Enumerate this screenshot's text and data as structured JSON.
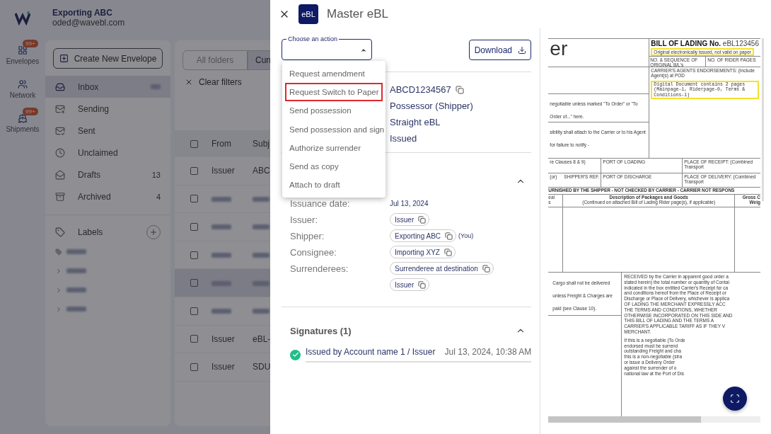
{
  "account": {
    "name": "Exporting ABC",
    "email": "oded@wavebl.com"
  },
  "rail": [
    {
      "label": "Envelopes",
      "badge": "99+"
    },
    {
      "label": "Network"
    },
    {
      "label": "Shipments",
      "badge": "99+"
    }
  ],
  "create_button": "Create New Envelope",
  "folders": [
    {
      "label": "Inbox",
      "selected": true,
      "count_blurred": true
    },
    {
      "label": "Sending",
      "selected": false
    },
    {
      "label": "Sent",
      "selected": false
    },
    {
      "label": "Unclaimed",
      "selected": false
    },
    {
      "label": "Drafts",
      "count": "13",
      "selected": false
    },
    {
      "label": "Archived",
      "count": "4",
      "selected": false
    }
  ],
  "labels": {
    "title": "Labels",
    "items": [
      {
        "expandable": false
      },
      {
        "expandable": true
      },
      {
        "expandable": true
      },
      {
        "expandable": true
      }
    ]
  },
  "filter_tabs": [
    {
      "label": "All folders",
      "selected": false
    },
    {
      "label": "Curr",
      "selected": true
    }
  ],
  "clear_filters": "Clear filters",
  "table": {
    "columns": [
      "From",
      "Subj"
    ],
    "rows": [
      {
        "from": "Issuer",
        "subject": "ABC",
        "blurred": false,
        "selected": false
      },
      {
        "blurred": true,
        "selected": false
      },
      {
        "blurred": true,
        "selected": false
      },
      {
        "blurred": true,
        "selected": false
      },
      {
        "blurred": true,
        "selected": true
      },
      {
        "blurred": true,
        "selected": false
      },
      {
        "from": "Issuer",
        "subject": "eBL-",
        "blurred": false,
        "selected": false
      },
      {
        "from": "Issuer",
        "subject": "SDU",
        "blurred": false,
        "selected": false
      }
    ]
  },
  "drawer": {
    "badge": "eBL",
    "title": "Master eBL",
    "action_select": {
      "label": "Choose an action",
      "expanded": true,
      "options": [
        {
          "label": "Request amendment",
          "outlined": false
        },
        {
          "label": "Request Switch to Paper",
          "outlined": true
        },
        {
          "label": "Send possession",
          "outlined": false
        },
        {
          "label": "Send possession and sign",
          "outlined": false
        },
        {
          "label": "Authorize surrender",
          "outlined": false
        },
        {
          "label": "Send as copy",
          "outlined": false
        },
        {
          "label": "Attach to draft",
          "outlined": false
        }
      ]
    },
    "download": "Download",
    "details": [
      {
        "value": "ABCD1234567",
        "copyable": true
      },
      {
        "value": "Possessor (Shipper)",
        "copyable": false
      },
      {
        "value": "Straight eBL",
        "copyable": false
      },
      {
        "value": "Issued",
        "copyable": false
      }
    ],
    "parties": {
      "expanded": true,
      "rows": [
        {
          "label": "Issuance date:",
          "kind": "text",
          "value": "Jul 13, 2024"
        },
        {
          "label": "Issuer:",
          "kind": "chips",
          "chips": [
            "Issuer"
          ]
        },
        {
          "label": "Shipper:",
          "kind": "chips",
          "chips": [
            "Exporting ABC"
          ],
          "note": "(You)"
        },
        {
          "label": "Consignee:",
          "kind": "chips",
          "chips": [
            "Importing XYZ"
          ]
        },
        {
          "label": "Surrenderees:",
          "kind": "chips",
          "chips": [
            "Surrenderee at destination",
            "Issuer"
          ]
        }
      ]
    },
    "signatures": {
      "title": "Signatures (1)",
      "expanded": true,
      "items": [
        {
          "text": "Issued by Account name 1 / Issuer",
          "time": "Jul 13, 2024, 10:38 AM",
          "signed": true
        }
      ]
    }
  },
  "document": {
    "logo_part": "er",
    "bl_title": "BILL OF LADING No.",
    "bl_number": "eBL123456",
    "validity_note": "Original electronically issued, not valid on paper",
    "seq_label": "NO. & SEQUENCE OF ORIGINAL B/L's",
    "rider_label": "NO. OF RIDER PAGES",
    "endorsements_label": "CARRIER'S AGENTS ENDORSEMENTS: (Include Agent(s) at POD",
    "digital_note": [
      "Digital Document contains 2 pages",
      "(Mainpage-1, Riderpage-0, Terms & Conditions-1)"
    ],
    "negotiable_note": "negotiable unless marked \"To Order\" or \"To Order of...\" here.",
    "notify_note": "sibility shall attach to the Carrier or to his Agent for failure to notify -",
    "clauses_note": "re Clauses 8 & 9)",
    "port_loading": "PORT OF LOADING",
    "place_receipt": "PLACE OF RECEIPT: (Combined Transport",
    "or_note": "(or)",
    "shipper_ref": "SHIPPER'S REF.",
    "port_discharge": "PORT OF DISCHARGE",
    "place_delivery": "PLACE OF DELIVERY: (Combined Transport",
    "banner": "URNISHED BY THE SHIPPER - NOT CHECKED BY CARRIER - CARRIER NOT RESPONS",
    "col_left": [
      "eal",
      "s"
    ],
    "description_title": "Description of Packages and Goods",
    "description_sub": "(Continued on attached Bill of Lading Rider page(s), if applicable)",
    "col_right": [
      "Gross C",
      "Weig"
    ],
    "cargo_note": "Cargo shall not be delivered unless Freight & Charges are paid (see Clause 10).",
    "received_lines": [
      "RECEIVED by the Carrier in apparent good order a",
      "stated herein) the total number or quantity of Contai",
      "indicated in the box entitled Carrier's Receipt for ca",
      "and conditions hereof from the Place of Receipt or",
      "Discharge or Place of Delivery, whichever is applica",
      "OF LADING THE MERCHANT EXPRESSLY ACC",
      "THE TERMS AND CONDITIONS, WHETHER",
      "OTHERWISE INCORPORATED ON THIS SIDE AND",
      "THIS BILL OF LADING AND THE TERMS A",
      "CARRIER'S APPLICABLE TARIFF AS IF THEY V",
      "MERCHANT."
    ],
    "negotiable_lines": [
      "If this is a negotiable (To Orde",
      "endorsed must be surrend",
      "outstanding Freight and cha",
      "this is a non-negotiable (stra",
      "or issue a Delivery Order",
      "against the surrender of o",
      "national law at the Port of Dis"
    ]
  }
}
